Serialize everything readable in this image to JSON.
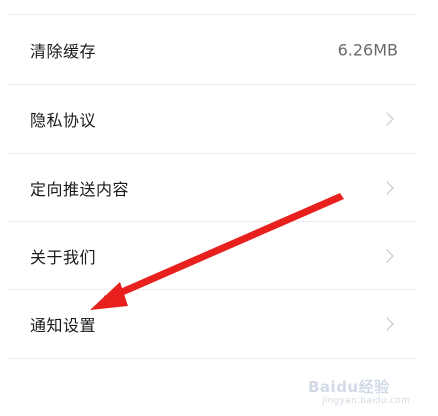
{
  "settings_list": {
    "items": [
      {
        "label": "清除缓存",
        "value": "6.26MB",
        "has_chevron": false
      },
      {
        "label": "隐私协议",
        "value": "",
        "has_chevron": true
      },
      {
        "label": "定向推送内容",
        "value": "",
        "has_chevron": true
      },
      {
        "label": "关于我们",
        "value": "",
        "has_chevron": true
      },
      {
        "label": "通知设置",
        "value": "",
        "has_chevron": true
      }
    ]
  },
  "annotation": {
    "arrow_color": "#e8211f",
    "points_to": "通知设置"
  },
  "watermark": {
    "logo_text": "Baidu经验",
    "sub_text": "jingyan.baidu.com"
  },
  "colors": {
    "background": "#ffffff",
    "divider": "#ececec",
    "label_text": "#1a1a1a",
    "value_text": "#6a6a6a",
    "chevron": "#d0d0d0"
  },
  "icons": {
    "chevron": "chevron-right-icon"
  }
}
